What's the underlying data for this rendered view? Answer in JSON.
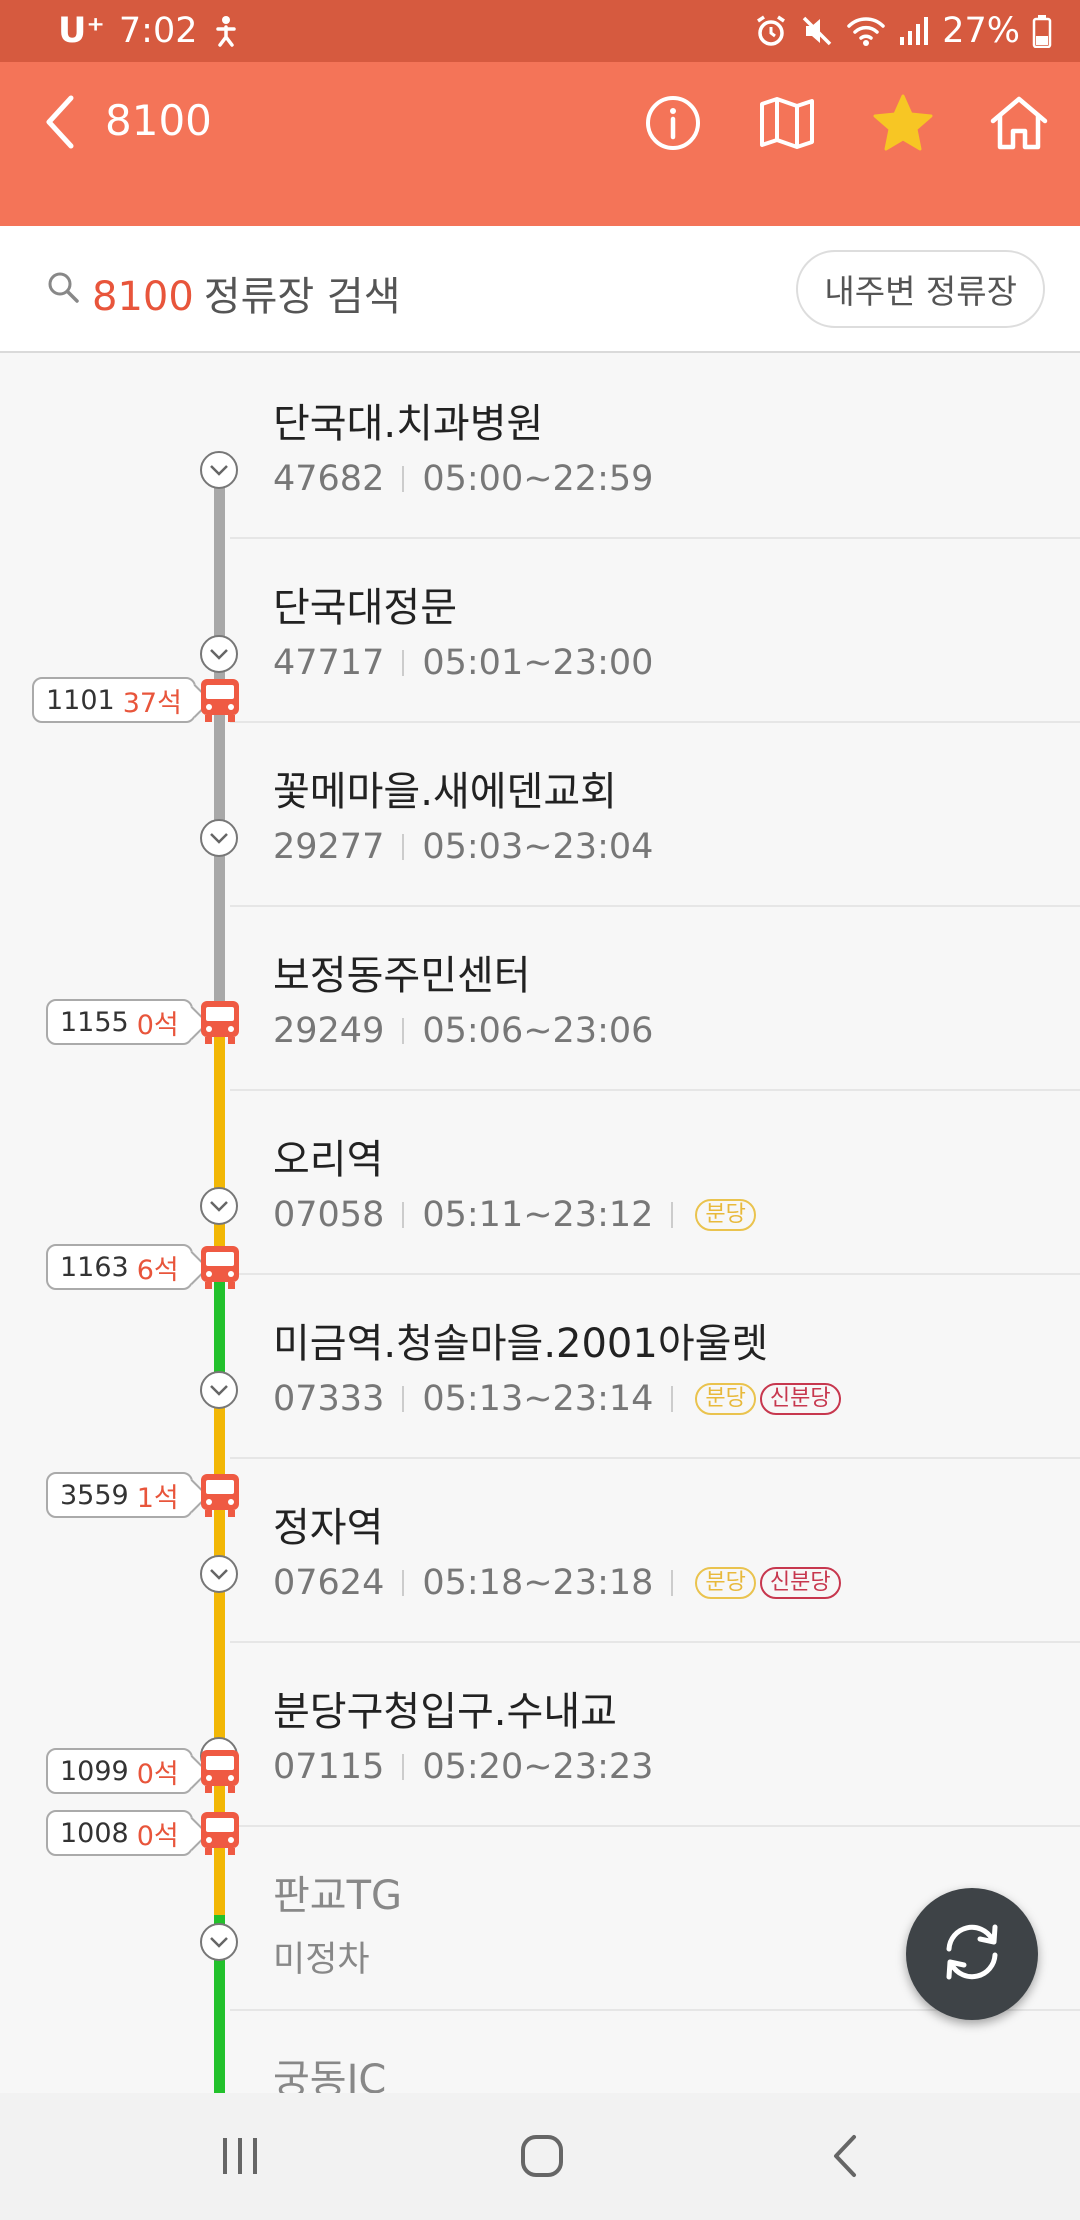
{
  "status_bar": {
    "carrier": "U⁺",
    "time": "7:02",
    "battery": "27%"
  },
  "app_bar": {
    "route_number": "8100"
  },
  "search": {
    "route": "8100",
    "label": "정류장 검색",
    "nearby_label": "내주변 정류장"
  },
  "stops": [
    {
      "name": "단국대.치과병원",
      "id": "47682",
      "hours": "05:00~22:59",
      "badges": []
    },
    {
      "name": "단국대정문",
      "id": "47717",
      "hours": "05:01~23:00",
      "badges": []
    },
    {
      "name": "꽃메마을.새에덴교회",
      "id": "29277",
      "hours": "05:03~23:04",
      "badges": []
    },
    {
      "name": "보정동주민센터",
      "id": "29249",
      "hours": "05:06~23:06",
      "badges": []
    },
    {
      "name": "오리역",
      "id": "07058",
      "hours": "05:11~23:12",
      "badges": [
        "분당"
      ]
    },
    {
      "name": "미금역.청솔마을.2001아울렛",
      "id": "07333",
      "hours": "05:13~23:14",
      "badges": [
        "분당",
        "신분당"
      ]
    },
    {
      "name": "정자역",
      "id": "07624",
      "hours": "05:18~23:18",
      "badges": [
        "분당",
        "신분당"
      ]
    },
    {
      "name": "분당구청입구.수내교",
      "id": "07115",
      "hours": "05:20~23:23",
      "badges": []
    },
    {
      "name": "판교TG",
      "status": "미정차"
    },
    {
      "name": "궁동IC"
    }
  ],
  "buses": [
    {
      "plate": "1101",
      "seats": "37석"
    },
    {
      "plate": "1155",
      "seats": "0석"
    },
    {
      "plate": "1163",
      "seats": "6석"
    },
    {
      "plate": "3559",
      "seats": "1석"
    },
    {
      "plate": "1099",
      "seats": "0석"
    },
    {
      "plate": "1008",
      "seats": "0석"
    }
  ],
  "colors": {
    "status_bar": "#d65a3f",
    "app_bar": "#f47458",
    "accent": "#e8553b",
    "line_gray": "#a8a8a8",
    "line_yellow": "#f2b705",
    "line_green": "#22c12b",
    "bus": "#ef5a43",
    "star": "#f7c624"
  },
  "icons": [
    "back-icon",
    "info-icon",
    "map-icon",
    "star-icon",
    "home-icon",
    "search-icon",
    "chevron-down-icon",
    "bus-icon",
    "refresh-icon"
  ]
}
